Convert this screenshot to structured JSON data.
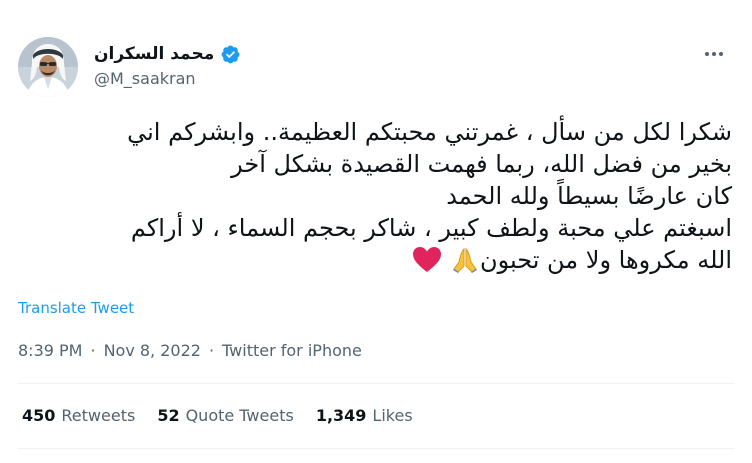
{
  "author": {
    "display_name": "محمد السكران",
    "handle": "@M_saakran",
    "verified": true
  },
  "tweet": {
    "lines": [
      "شكرا لكل من سأل ، غمرتني محبتكم العظيمة.. وابشركم اني",
      "بخير من فضل الله، ربما فهمت القصيدة بشكل آخر",
      "كان عارضًا بسيطاً ولله الحمد",
      "اسبغتم علي محبة ولطف كبير ، شاكر بحجم السماء ، لا أراكم",
      "الله مكروها ولا من تحبون"
    ],
    "emojis": [
      "folded-hands-icon",
      "red-heart-icon"
    ]
  },
  "translate_label": "Translate Tweet",
  "meta": {
    "time": "8:39 PM",
    "date": "Nov 8, 2022",
    "source": "Twitter for iPhone",
    "separator": "·"
  },
  "stats": {
    "retweets": {
      "count": "450",
      "label": "Retweets"
    },
    "quote_tweets": {
      "count": "52",
      "label": "Quote Tweets"
    },
    "likes": {
      "count": "1,349",
      "label": "Likes"
    }
  },
  "colors": {
    "accent": "#1d9bf0",
    "text": "#0f1419",
    "secondary": "#536471",
    "divider": "#eff3f4",
    "heart": "#e0245e"
  }
}
